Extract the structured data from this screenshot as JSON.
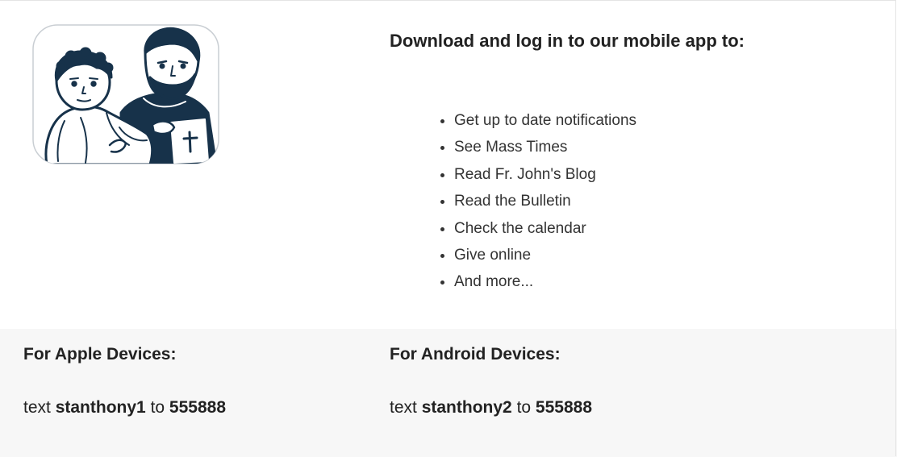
{
  "app": {
    "icon": "st-anthony-and-child-jesus-logo",
    "heading": "Download and log in to our mobile app to:",
    "features": [
      "Get up to date notifications",
      "See Mass Times",
      "Read Fr. John's Blog",
      "Read the Bulletin",
      "Check the calendar",
      "Give online",
      "And more..."
    ]
  },
  "apple": {
    "title": "For Apple Devices:",
    "text_prefix": "text",
    "keyword": "stanthony1",
    "text_mid": "to",
    "number": "555888"
  },
  "android": {
    "title": "For Android Devices:",
    "text_prefix": "text",
    "keyword": "stanthony2",
    "text_mid": "to",
    "number": "555888"
  },
  "colors": {
    "ink": "#17324a",
    "panel": "#f7f7f7"
  }
}
